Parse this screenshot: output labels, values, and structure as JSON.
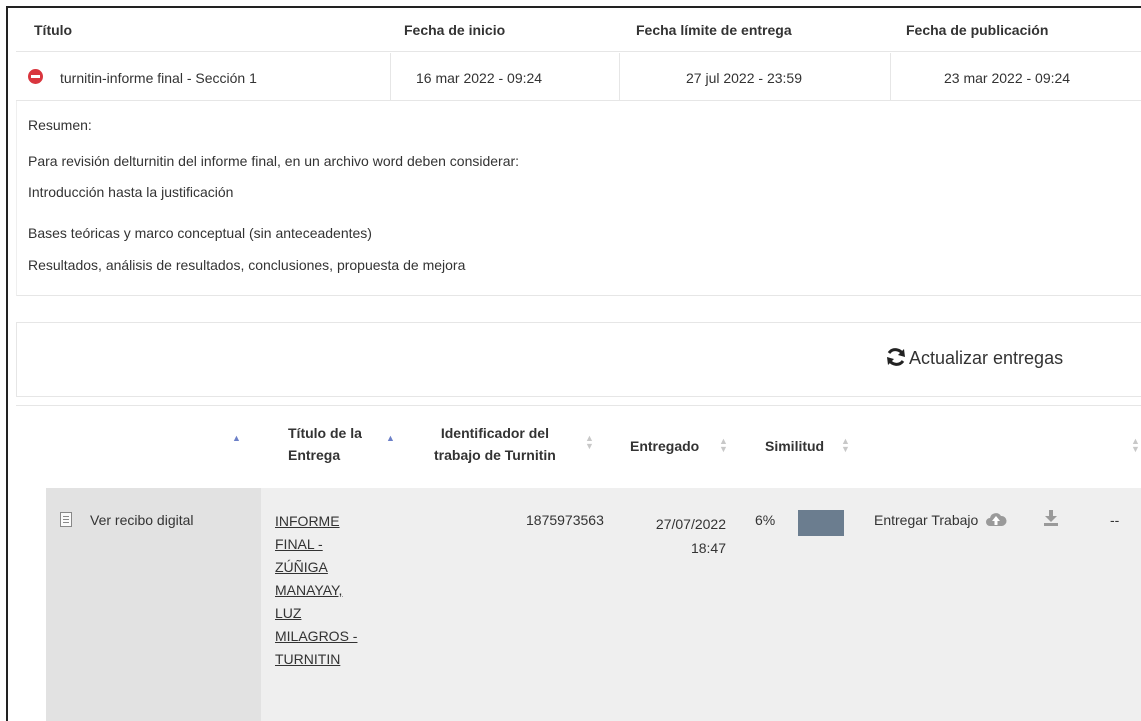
{
  "header": {
    "col_title": "Título",
    "col_start": "Fecha de inicio",
    "col_due": "Fecha límite de entrega",
    "col_post": "Fecha de publicación"
  },
  "assignment": {
    "title": "turnitin-informe final - Sección 1",
    "start_date": "16 mar 2022 - 09:24",
    "due_date": "27 jul 2022 - 23:59",
    "post_date": "23 mar 2022 - 09:24"
  },
  "summary": {
    "label": "Resumen:",
    "lines": [
      "Para revisión delturnitin del informe final, en un archivo word deben considerar:",
      "Introducción hasta la justificación",
      "Bases teóricas y marco conceptual (sin anteceadentes)",
      "Resultados, análisis de resultados, conclusiones, propuesta de mejora"
    ]
  },
  "refresh": {
    "label": "Actualizar entregas",
    "icon": "refresh-icon"
  },
  "submissions": {
    "headers": {
      "title_l1": "Título de la",
      "title_l2": "Entrega",
      "id_l1": "Identificador del",
      "id_l2": "trabajo de Turnitin",
      "submitted": "Entregado",
      "similarity": "Similitud"
    },
    "row": {
      "receipt": "Ver recibo digital",
      "title_lines": [
        "INFORME",
        "FINAL -",
        "ZÚÑIGA",
        "MANAYAY,",
        "LUZ",
        "MILAGROS -",
        "TURNITIN"
      ],
      "paper_id": "1875973563",
      "date": "27/07/2022",
      "time": "18:47",
      "similarity": "6%",
      "similarity_pct": 6,
      "submit_label": "Entregar Trabajo",
      "trailing": "--"
    }
  },
  "colors": {
    "accent_sort": "#6c80c8",
    "minus": "#d9363e",
    "sim_bar": "#6b7d8f"
  }
}
